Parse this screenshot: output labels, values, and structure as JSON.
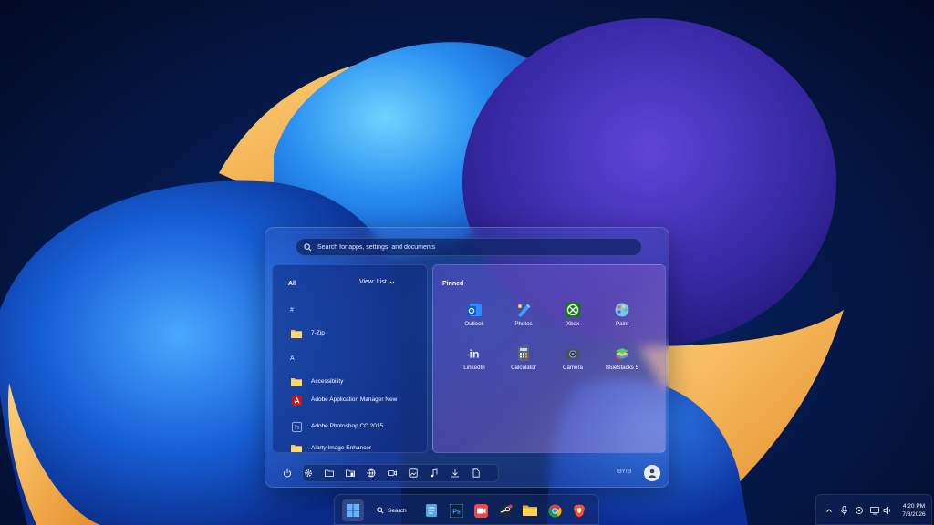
{
  "start_menu": {
    "search_placeholder": "Search for apps, settings, and documents",
    "all_panel": {
      "title": "All",
      "view_label": "View: List",
      "groups": [
        "#",
        "A"
      ],
      "apps": [
        {
          "name": "7-Zip",
          "icon": "folder-icon"
        },
        {
          "name": "Accessibility",
          "icon": "folder-icon"
        },
        {
          "name": "Adobe Application Manager New",
          "icon": "adobe-icon"
        },
        {
          "name": "Adobe Photoshop CC 2015",
          "icon": "photoshop-icon"
        },
        {
          "name": "Aiarty Image Enhancer",
          "icon": "folder-icon"
        }
      ]
    },
    "pinned_panel": {
      "title": "Pinned",
      "apps": [
        {
          "name": "Outlook",
          "icon": "outlook-icon"
        },
        {
          "name": "Photos",
          "icon": "photos-icon"
        },
        {
          "name": "Xbox",
          "icon": "xbox-icon"
        },
        {
          "name": "Paint",
          "icon": "paint-icon"
        },
        {
          "name": "LinkedIn",
          "icon": "linkedin-icon"
        },
        {
          "name": "Calculator",
          "icon": "calculator-icon"
        },
        {
          "name": "Camera",
          "icon": "camera-icon"
        },
        {
          "name": "BlueStacks 5",
          "icon": "bluestacks-icon"
        }
      ]
    },
    "bottom_bar": {
      "user_name": "ӨYrӨ",
      "icons": [
        "power-icon",
        "settings-icon",
        "file-explorer-icon",
        "documents-icon",
        "network-icon",
        "videos-icon",
        "pictures-icon",
        "music-icon",
        "downloads-icon",
        "file-icon"
      ]
    }
  },
  "taskbar": {
    "search_label": "Search",
    "apps": [
      "start-icon",
      "search-icon",
      "notepad-icon",
      "photoshop-icon",
      "media-icon",
      "steam-icon",
      "file-explorer-icon",
      "chrome-icon",
      "brave-icon"
    ]
  },
  "tray": {
    "time": "4:20 PM",
    "date": "7/8/2026"
  },
  "colors": {
    "wallpaper_dark": "#020a24",
    "wallpaper_blue": "#1e6fe0",
    "accent_orange": "#f5b04a",
    "accent_purple": "#5a3fc8"
  }
}
